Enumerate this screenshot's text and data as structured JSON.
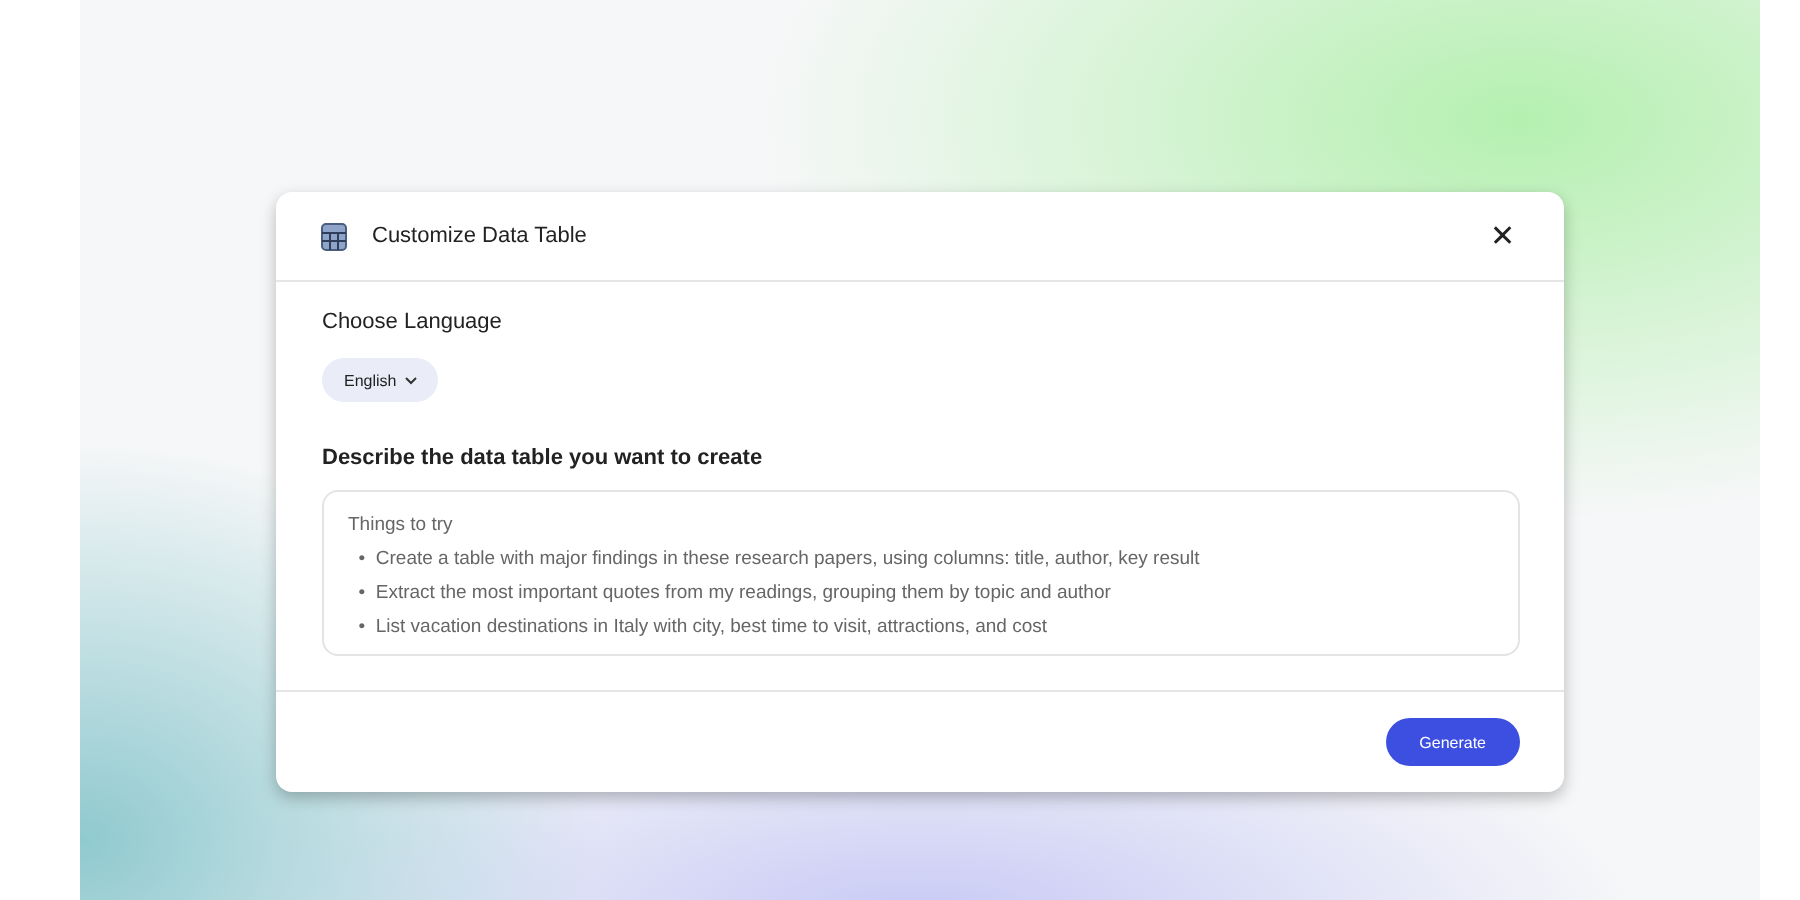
{
  "dialog": {
    "title": "Customize Data Table",
    "close": "✕",
    "language": {
      "label": "Choose Language",
      "value": "English"
    },
    "description": {
      "label": "Describe the data table you want to create",
      "placeholder": "Things to try\n  •  Create a table with major findings in these research papers, using columns: title, author, key result\n  •  Extract the most important quotes from my readings, grouping them by topic and author\n  •  List vacation destinations in Italy with city, best time to visit, attractions, and cost"
    },
    "buttons": [
      "Generate"
    ]
  }
}
